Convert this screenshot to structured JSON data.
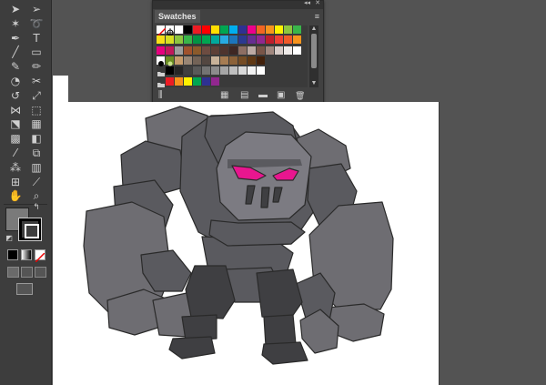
{
  "swatches_panel": {
    "title": "Swatches",
    "collapse_glyph": "◂◂",
    "close_glyph": "✕",
    "menu_glyph": "≡",
    "bottom_buttons": [
      "library-icon",
      "swatch-kinds-icon",
      "swatch-options-icon",
      "new-group-icon",
      "new-swatch-icon",
      "delete-swatch-icon"
    ],
    "rows": [
      [
        "none",
        "registration",
        "#ffffff",
        "#000000",
        "#ed1c24",
        "#ff0000",
        "#ffde00",
        "#00a651",
        "#00aeef",
        "#2e3192",
        "#ec008c",
        "#f26522",
        "#f7941d",
        "#fff200",
        "#8dc63f",
        "#39b54a"
      ],
      [
        "#f7e017",
        "#d7df23",
        "#8dc63f",
        "#39b54a",
        "#009444",
        "#00a651",
        "#00a99d",
        "#27aae1",
        "#1c75bc",
        "#2b3990",
        "#662d91",
        "#92278f",
        "#be1e2d",
        "#ef4136",
        "#f15a29",
        "#f7941d"
      ],
      [
        "#e6007e",
        "#c2185b",
        "#9e9e9e",
        "#a0522d",
        "#8b5a2b",
        "#6d4c41",
        "#5d4037",
        "#4e342e",
        "#3e2723",
        "#8d6e63",
        "#bcaaa4",
        "#795548",
        "#a1887f",
        "#d7ccc8",
        "#efebe9",
        "#ffffff"
      ],
      [
        "pattern-circle",
        "pattern-flower",
        "#c69c6d",
        "#998675",
        "#736357",
        "#534741",
        "#c7b299",
        "#a67c52",
        "#8c6239",
        "#754c24",
        "#603813",
        "#42210b"
      ],
      [
        "folder",
        "#000000",
        "#262626",
        "#404040",
        "#595959",
        "#737373",
        "#8c8c8c",
        "#a6a6a6",
        "#bfbfbf",
        "#d9d9d9",
        "#f2f2f2",
        "#ffffff"
      ],
      [
        "folder",
        "#ed1c24",
        "#f7941d",
        "#fff200",
        "#00a651",
        "#2e3192",
        "#92278f"
      ]
    ]
  },
  "toolbar": {
    "tools": [
      [
        "selection-tool-icon",
        "direct-selection-tool-icon"
      ],
      [
        "magic-wand-tool-icon",
        "lasso-tool-icon"
      ],
      [
        "pen-tool-icon",
        "type-tool-icon"
      ],
      [
        "line-tool-icon",
        "rectangle-tool-icon"
      ],
      [
        "paintbrush-tool-icon",
        "pencil-tool-icon"
      ],
      [
        "blob-brush-tool-icon",
        "eraser-tool-icon"
      ],
      [
        "rotate-tool-icon",
        "scale-tool-icon"
      ],
      [
        "width-tool-icon",
        "free-transform-tool-icon"
      ],
      [
        "shape-builder-tool-icon",
        "perspective-grid-tool-icon"
      ],
      [
        "mesh-tool-icon",
        "gradient-tool-icon"
      ],
      [
        "eyedropper-tool-icon",
        "blend-tool-icon"
      ],
      [
        "symbol-sprayer-tool-icon",
        "column-graph-tool-icon"
      ],
      [
        "artboard-tool-icon",
        "slice-tool-icon"
      ],
      [
        "hand-tool-icon",
        "zoom-tool-icon"
      ]
    ],
    "fill_color": "#7a7a7a",
    "stroke_color": "#000000"
  },
  "colors": {
    "app_bg": "#535353",
    "toolbar_bg": "#3d3d3d",
    "panel_bg": "#414141",
    "artboard": "#ffffff",
    "golem_light": "#6e6d72",
    "golem_mid": "#5a5a5f",
    "golem_dark": "#3f3f42",
    "golem_face": "#7c7b82",
    "golem_eye": "#e8168f",
    "outline": "#2a2a2a"
  }
}
